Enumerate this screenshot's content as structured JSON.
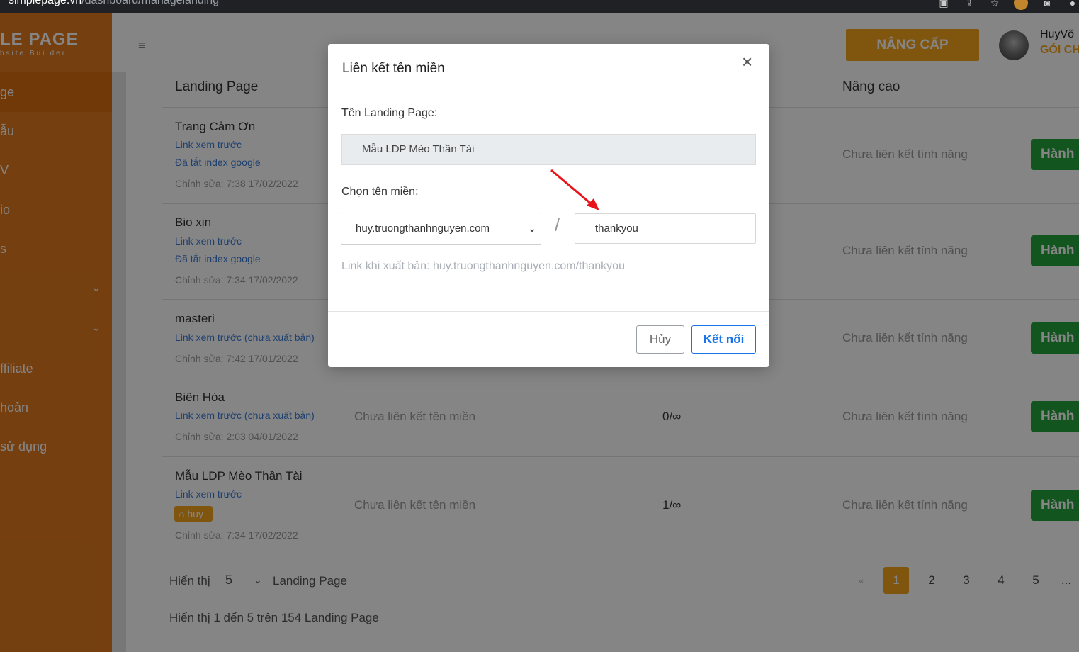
{
  "browser": {
    "url_host": "simplepage.vn",
    "url_path": "/dashboard/managelanding"
  },
  "sidebar": {
    "logo": "LE PAGE",
    "logo_sub": "bsite Builder",
    "items": [
      "ge",
      "ẫu",
      "V",
      "io",
      "s",
      "ffiliate",
      "hoản",
      "sử dụng"
    ]
  },
  "header": {
    "upgrade_label": "NÂNG CẤP",
    "user_name": "HuyVõ",
    "user_plan": "GÓI CH"
  },
  "table": {
    "col_landing": "Landing Page",
    "col_advanced": "Nâng cao",
    "rows": [
      {
        "title": "Trang Cảm Ơn",
        "link": "Link xem trước",
        "index": "Đã tắt index google",
        "edited": "Chỉnh sửa: 7:38 17/02/2022",
        "advanced": "Chưa liên kết tính năng",
        "action": "Hành"
      },
      {
        "title": "Bio xịn",
        "link": "Link xem trước",
        "index": "Đã tắt index google",
        "edited": "Chỉnh sửa: 7:34 17/02/2022",
        "advanced": "Chưa liên kết tính năng",
        "action": "Hành"
      },
      {
        "title": "masteri",
        "link": "Link xem trước (chưa xuất bản)",
        "edited": "Chỉnh sửa: 7:42 17/01/2022",
        "advanced": "Chưa liên kết tính năng",
        "action": "Hành"
      },
      {
        "title": "Biên Hòa",
        "link": "Link xem trước (chưa xuất bản)",
        "edited": "Chỉnh sửa: 2:03 04/01/2022",
        "domain": "Chưa liên kết tên miền",
        "count": "0/∞",
        "advanced": "Chưa liên kết tính năng",
        "action": "Hành"
      },
      {
        "title": "Mẫu LDP Mèo Thần Tài",
        "link": "Link xem trước",
        "tag": "huy",
        "edited": "Chỉnh sửa: 7:34 17/02/2022",
        "domain": "Chưa liên kết tên miền",
        "count": "1/∞",
        "advanced": "Chưa liên kết tính năng",
        "action": "Hành"
      }
    ]
  },
  "footer": {
    "show_label": "Hiển thị",
    "per_page": "5",
    "per_page_suffix": "Landing Page",
    "summary": "Hiển thị 1 đến 5 trên 154 Landing Page",
    "pages": [
      "1",
      "2",
      "3",
      "4",
      "5",
      "..."
    ],
    "prev": "«",
    "current_page": "1"
  },
  "modal": {
    "title": "Liên kết tên miền",
    "close": "×",
    "name_label": "Tên Landing Page:",
    "name_value": "Mẫu LDP Mèo Thần Tài",
    "domain_label": "Chọn tên miền:",
    "domain_value": "huy.truongthanhnguyen.com",
    "separator": "/",
    "slug_value": "thankyou",
    "publish_link": "Link khi xuất bản: huy.truongthanhnguyen.com/thankyou",
    "cancel_label": "Hủy",
    "connect_label": "Kết nối"
  },
  "colors": {
    "brand_orange": "#f5a51c",
    "sidebar_orange": "#e07a1f",
    "action_green": "#23a33a",
    "link_blue": "#3a7bd5",
    "primary_blue": "#1a73e8",
    "arrow_red": "#e8141b"
  }
}
